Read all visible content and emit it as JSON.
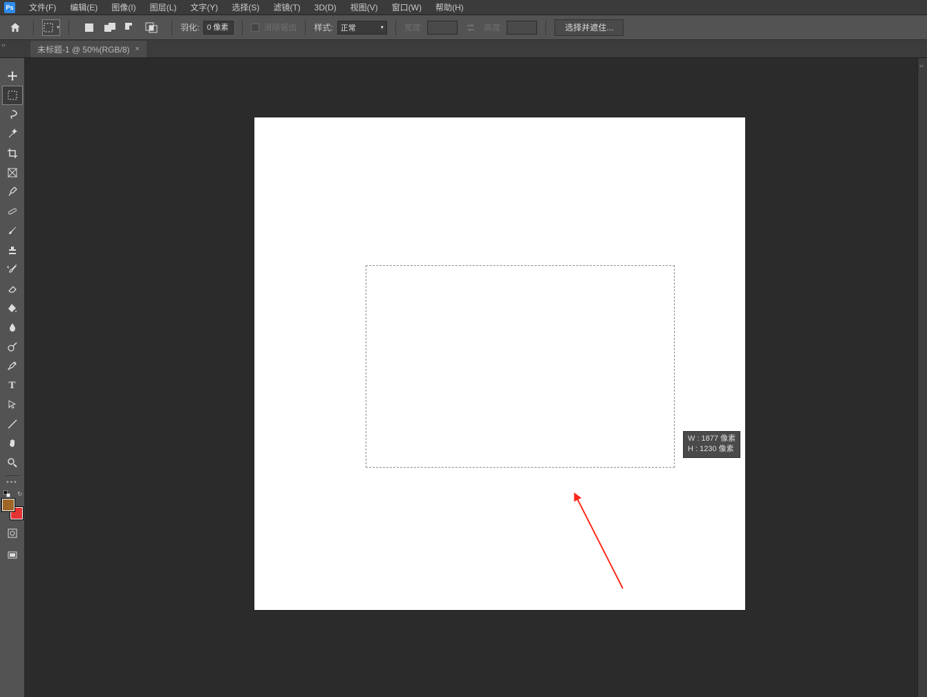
{
  "app": {
    "ps_label": "Ps"
  },
  "menu": {
    "file": "文件(F)",
    "edit": "编辑(E)",
    "image": "图像(I)",
    "layer": "图层(L)",
    "type": "文字(Y)",
    "select": "选择(S)",
    "filter": "滤镜(T)",
    "threeD": "3D(D)",
    "view": "视图(V)",
    "window": "窗口(W)",
    "help": "帮助(H)"
  },
  "options": {
    "feather_label": "羽化:",
    "feather_value": "0 像素",
    "antialias_label": "消除锯齿",
    "style_label": "样式:",
    "style_value": "正常",
    "width_label": "宽度:",
    "height_label": "高度:",
    "select_mask_btn": "选择并遮住..."
  },
  "tab": {
    "title": "未标题-1 @ 50%(RGB/8)",
    "close": "×"
  },
  "tooltip": {
    "w_line": "W : 1877 像素",
    "h_line": "H : 1230 像素"
  },
  "colors": {
    "foreground": "#a06628",
    "background": "#e33333"
  }
}
